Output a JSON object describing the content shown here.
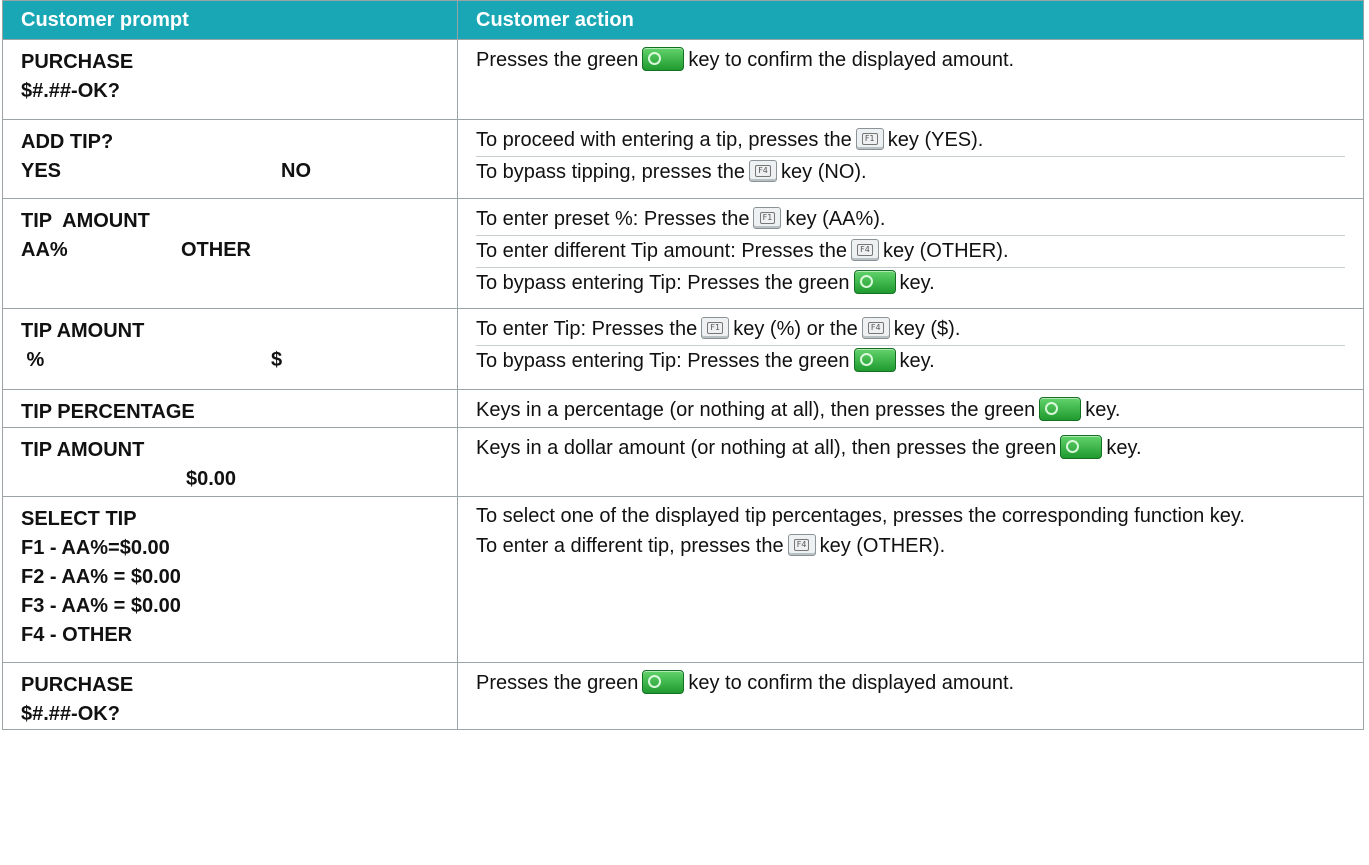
{
  "headers": {
    "prompt": "Customer prompt",
    "action": "Customer action"
  },
  "rows": [
    {
      "prompt_lines": [
        {
          "l": "PURCHASE",
          "r": ""
        },
        {
          "l": "$#.##-OK?",
          "r": ""
        }
      ],
      "actions": [
        {
          "pre": "Presses the green",
          "key": "green",
          "post": "key to confirm the displayed amount."
        }
      ]
    },
    {
      "prompt_lines": [
        {
          "l": "ADD TIP?",
          "r": ""
        },
        {
          "l": "YES",
          "r": "NO"
        }
      ],
      "actions": [
        {
          "pre": "To proceed with entering a tip, presses the",
          "key": "F1",
          "post": "key (YES)."
        },
        {
          "pre": "To bypass tipping, presses the",
          "key": "F4",
          "post": "key (NO)."
        }
      ]
    },
    {
      "prompt_lines": [
        {
          "l": "TIP  AMOUNT",
          "r": ""
        },
        {
          "l": "AA%",
          "r": "OTHER"
        }
      ],
      "actions": [
        {
          "pre": "To enter preset %: Presses the",
          "key": "F1",
          "post": "key (AA%)."
        },
        {
          "pre": "To enter different Tip amount: Presses the",
          "key": "F4",
          "post": "key (OTHER)."
        },
        {
          "pre": "To bypass entering Tip: Presses the green",
          "key": "green",
          "post": "key."
        }
      ]
    },
    {
      "prompt_lines": [
        {
          "l": "TIP AMOUNT",
          "r": ""
        },
        {
          "l": " %",
          "r": "$"
        }
      ],
      "actions": [
        {
          "pre": "To enter Tip: Presses the",
          "key": "F1",
          "post": "key (%) or the",
          "key2": "F4",
          "post2": "key ($)."
        },
        {
          "pre": "To bypass entering Tip: Presses the green",
          "key": "green",
          "post": "key."
        }
      ]
    },
    {
      "prompt_lines": [
        {
          "l": "TIP PERCENTAGE",
          "r": ""
        }
      ],
      "actions": [
        {
          "pre": "Keys in a percentage (or nothing at all), then presses the green",
          "key": "green",
          "post": "key."
        }
      ]
    },
    {
      "prompt_lines": [
        {
          "l": "TIP AMOUNT",
          "r": ""
        },
        {
          "l": "",
          "r": "$0.00"
        }
      ],
      "actions": [
        {
          "pre": "Keys in a dollar amount (or nothing at all), then presses the green",
          "key": "green",
          "post": "key."
        }
      ]
    },
    {
      "prompt_lines": [
        {
          "l": "SELECT TIP",
          "r": ""
        },
        {
          "l": "F1 - AA%=$0.00",
          "r": ""
        },
        {
          "l": "F2 - AA% = $0.00",
          "r": ""
        },
        {
          "l": "F3 - AA% = $0.00",
          "r": ""
        },
        {
          "l": "F4 - OTHER",
          "r": ""
        }
      ],
      "actions": [
        {
          "text": "To select one of the displayed tip percentages, presses the corresponding function key."
        },
        {
          "pre": "To enter a different tip, presses the",
          "key": "F4",
          "post": "key (OTHER)."
        }
      ]
    },
    {
      "prompt_lines": [
        {
          "l": "PURCHASE",
          "r": ""
        },
        {
          "l": "$#.##-OK?",
          "r": ""
        }
      ],
      "actions": [
        {
          "pre": "Presses the green",
          "key": "green",
          "post": "key to confirm the displayed amount."
        }
      ]
    }
  ]
}
